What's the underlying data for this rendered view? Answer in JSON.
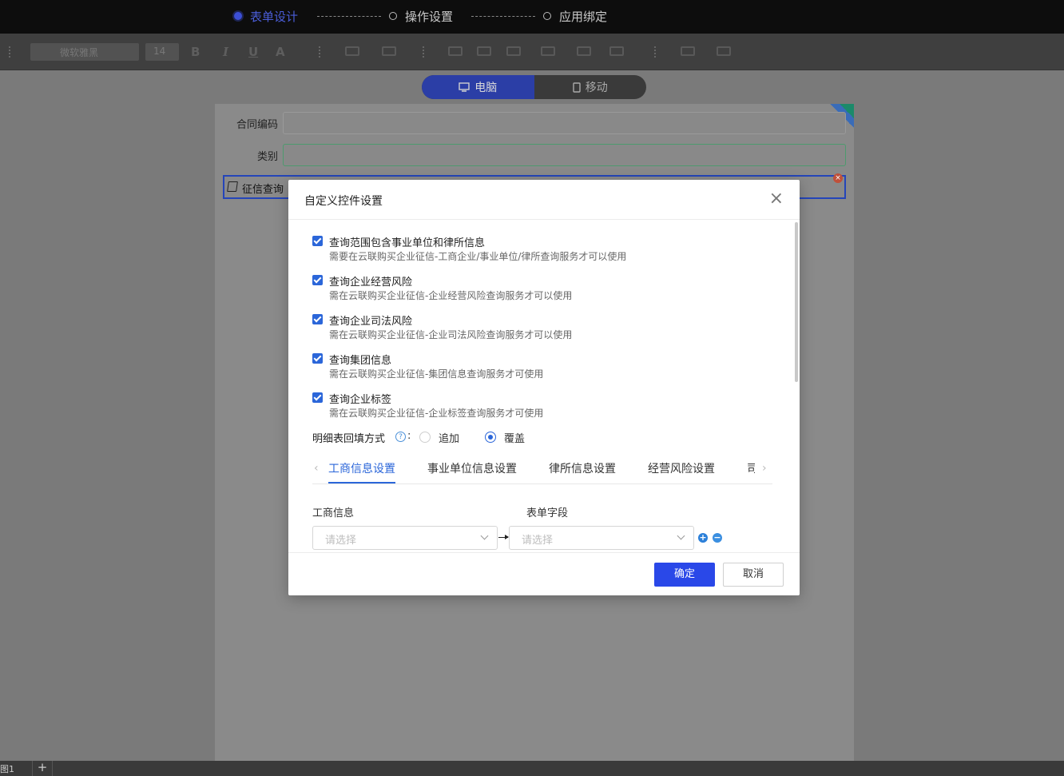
{
  "steps": [
    {
      "label": "表单设计",
      "active": true
    },
    {
      "label": "操作设置",
      "active": false
    },
    {
      "label": "应用绑定",
      "active": false
    }
  ],
  "toolbar": {
    "font_name": "微软雅黑",
    "font_size": "14",
    "bold": "B",
    "italic": "I",
    "underline": "U",
    "font_color": "A"
  },
  "device_toggle": {
    "desktop": "电脑",
    "mobile": "移动"
  },
  "form": {
    "fields": [
      {
        "label": "合同编码"
      },
      {
        "label": "类别"
      }
    ],
    "selected_field_label": "征信查询"
  },
  "bottombar": {
    "sheet": "图1",
    "add": "+"
  },
  "dialog": {
    "title": "自定义控件设置",
    "close": "×",
    "options": [
      {
        "title": "查询范围包含事业单位和律所信息",
        "desc": "需要在云联购买企业征信-工商企业/事业单位/律所查询服务才可以使用",
        "checked": true
      },
      {
        "title": "查询企业经营风险",
        "desc": "需在云联购买企业征信-企业经营风险查询服务才可以使用",
        "checked": true
      },
      {
        "title": "查询企业司法风险",
        "desc": "需在云联购买企业征信-企业司法风险查询服务才可以使用",
        "checked": true
      },
      {
        "title": "查询集团信息",
        "desc": "需在云联购买企业征信-集团信息查询服务才可使用",
        "checked": true
      },
      {
        "title": "查询企业标签",
        "desc": "需在云联购买企业征信-企业标签查询服务才可使用",
        "checked": true
      }
    ],
    "fill_mode": {
      "label": "明细表回填方式",
      "help": "?",
      "colon": ":",
      "options": [
        "追加",
        "覆盖"
      ],
      "selected": "覆盖"
    },
    "tabs": [
      "工商信息设置",
      "事业单位信息设置",
      "律所信息设置",
      "经营风险设置",
      "司"
    ],
    "active_tab": "工商信息设置",
    "mapping": {
      "source_header": "工商信息",
      "target_header": "表单字段",
      "source_placeholder": "请选择",
      "target_placeholder": "请选择"
    },
    "ok": "确定",
    "cancel": "取消"
  },
  "colors": {
    "primary": "#2a48e8",
    "check": "#2b66d9",
    "active_step": "#3c4fd6",
    "add_icon": "#2b7fd9",
    "remove_icon": "#3b8fe0"
  }
}
